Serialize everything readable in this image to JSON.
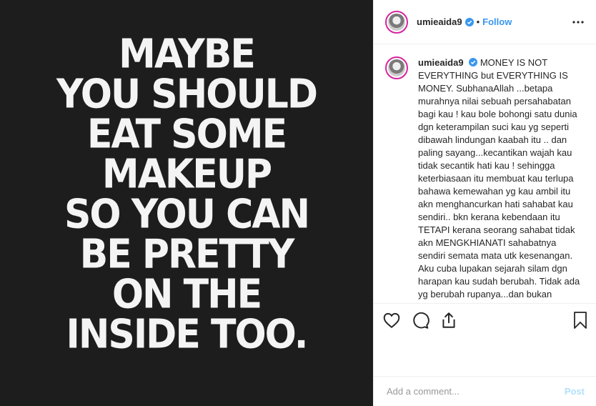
{
  "image": {
    "quote_lines": [
      "MAYBE",
      "YOU SHOULD",
      "EAT SOME",
      "MAKEUP",
      "SO YOU CAN",
      "BE PRETTY",
      "ON THE",
      "INSIDE TOO."
    ]
  },
  "header": {
    "username": "umieaida9",
    "separator": "•",
    "follow_label": "Follow"
  },
  "caption": {
    "username": "umieaida9",
    "text": "MONEY IS NOT EVERYTHING but EVERYTHING IS MONEY. SubhanaAllah ...betapa murahnya nilai sebuah persahabatan bagi kau ! kau bole bohongi satu dunia dgn keterampilan suci kau yg seperti dibawah lindungan kaabah itu .. dan paling sayang...kecantikan wajah kau tidak secantik hati kau ! sehingga keterbiasaan itu membuat kau terlupa bahawa kemewahan yg kau ambil itu akn menghancurkan hati sahabat kau sendiri.. bkn kerana kebendaan itu TETAPI kerana seorang sahabat tidak akn MENGKHIANATI sahabatnya sendiri semata mata utk kesenangan. Aku cuba lupakan sejarah silam dgn harapan kau sudah berubah. Tidak ada yg berubah rupanya...dan bukan"
  },
  "comment_box": {
    "placeholder": "Add a comment...",
    "post_label": "Post"
  },
  "colors": {
    "link": "#3897f0",
    "verified": "#3897f0",
    "image_bg": "#1d1d1d"
  },
  "icons": {
    "like": "heart-icon",
    "comment": "comment-bubble-icon",
    "share": "share-icon",
    "save": "bookmark-icon",
    "more": "more-options-icon",
    "verified": "verified-badge-icon"
  }
}
